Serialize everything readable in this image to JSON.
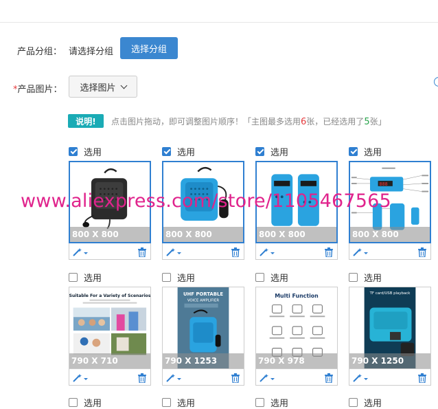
{
  "form": {
    "group_label": "产品分组：",
    "group_placeholder": "请选择分组",
    "group_button": "选择分组",
    "images_required_mark": "*",
    "images_label": "产品图片：",
    "images_button": "选择图片"
  },
  "notice": {
    "badge": "说明!",
    "text_1": "点击图片拖动，即可调整图片顺序！「主图最多选用",
    "max_count": "6",
    "text_2": "张，已经选用了",
    "used_count": "5",
    "text_3": "张」"
  },
  "watermark": "www.aliexpress.com/store/1105467565",
  "select_label": "选用",
  "colors": {
    "primary": "#3b87d0",
    "badge": "#1aabb5",
    "selected_border": "#2f7fd1",
    "watermark": "#e0238c",
    "red": "#e4393c",
    "green": "#27a34a"
  },
  "images": [
    {
      "checked": true,
      "size": "800 X 800",
      "scene": "black-speaker"
    },
    {
      "checked": true,
      "size": "800 X 800",
      "scene": "blue-speaker"
    },
    {
      "checked": true,
      "size": "800 X 800",
      "scene": "blue-side-views"
    },
    {
      "checked": true,
      "size": "800 X 800",
      "scene": "diagram"
    },
    {
      "checked": false,
      "size": "790 X 710",
      "scene": "scenarios",
      "caption": "Suitable For a Variety of Scenarios"
    },
    {
      "checked": false,
      "size": "790 X 1253",
      "scene": "uhf-poster",
      "caption": "UHF PORTABLE VOICE AMPLIFIER"
    },
    {
      "checked": false,
      "size": "790 X 978",
      "scene": "multi-function",
      "caption": "Multi Function"
    },
    {
      "checked": false,
      "size": "790 X 1250",
      "scene": "tf-card",
      "caption": "TF card/USB playback"
    },
    {
      "checked": false
    },
    {
      "checked": false
    },
    {
      "checked": false
    },
    {
      "checked": false
    }
  ]
}
